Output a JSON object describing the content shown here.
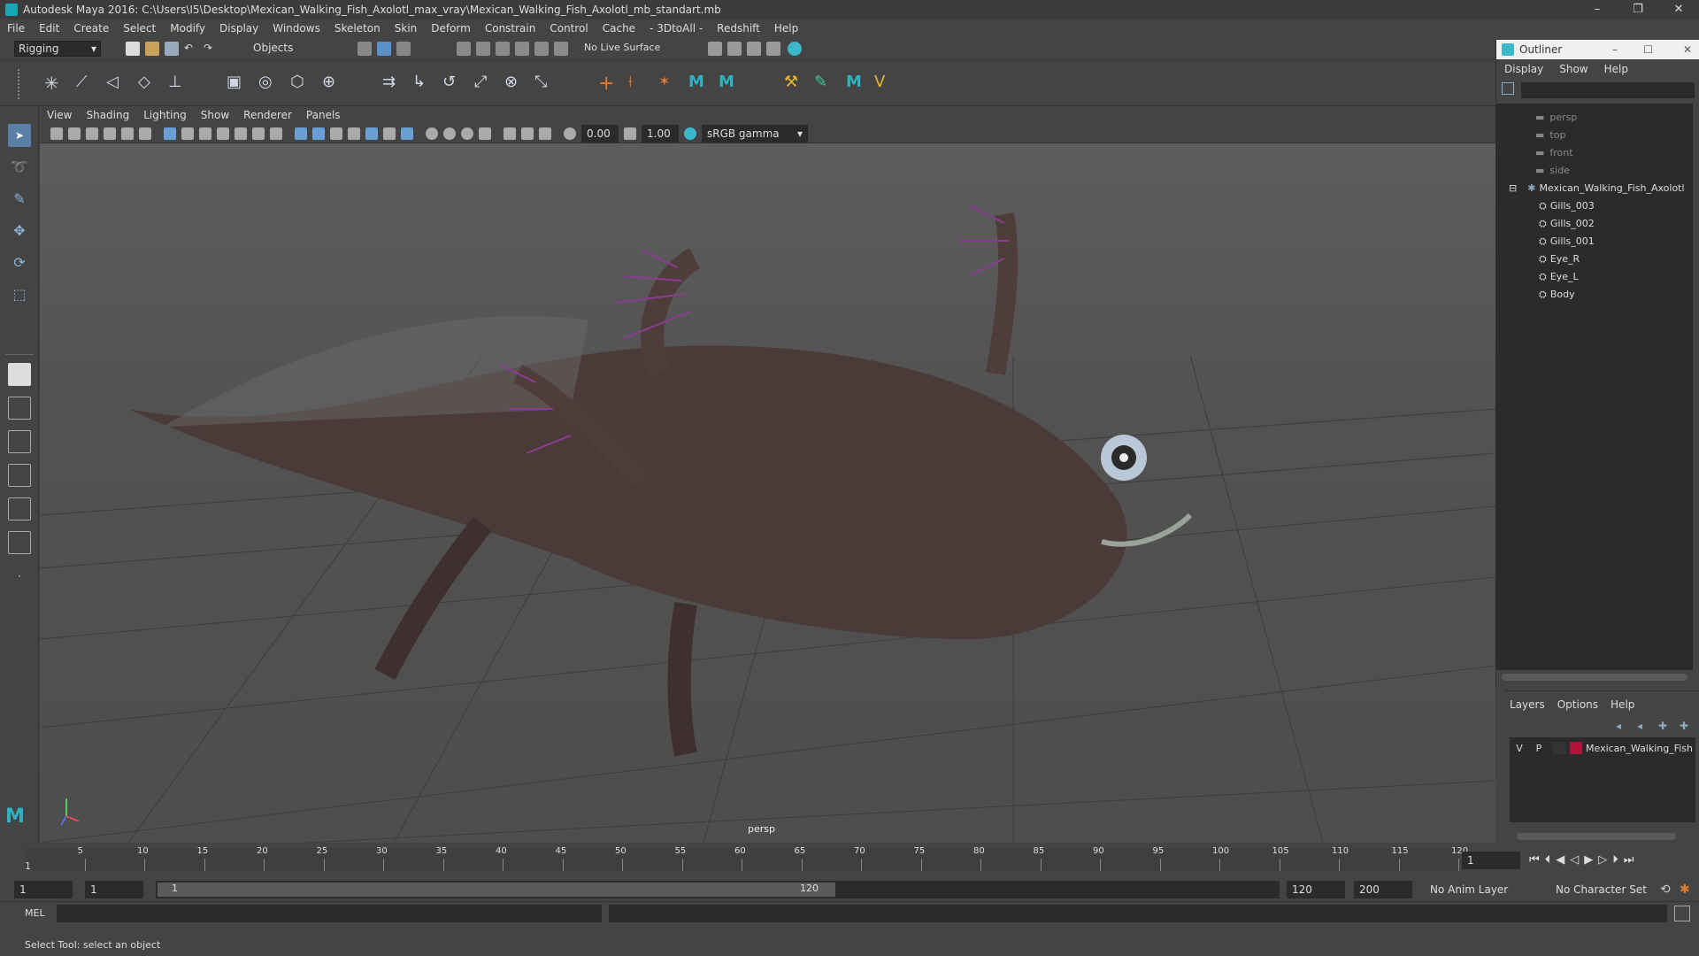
{
  "window": {
    "title": "Autodesk Maya 2016: C:\\Users\\I5\\Desktop\\Mexican_Walking_Fish_Axolotl_max_vray\\Mexican_Walking_Fish_Axolotl_mb_standart.mb",
    "minimize": "–",
    "restore": "❐",
    "close": "✕"
  },
  "menubar": [
    "File",
    "Edit",
    "Create",
    "Select",
    "Modify",
    "Display",
    "Windows",
    "Skeleton",
    "Skin",
    "Deform",
    "Constrain",
    "Control",
    "Cache",
    "- 3DtoAll -",
    "Redshift",
    "Help"
  ],
  "statusline": {
    "mode": "Rigging",
    "selection_mask": "Objects",
    "live_surface": "No Live Surface"
  },
  "panel_menu": [
    "View",
    "Shading",
    "Lighting",
    "Show",
    "Renderer",
    "Panels"
  ],
  "panel_toolbar": {
    "exposure": "0.00",
    "gamma": "1.00",
    "color_space": "sRGB gamma"
  },
  "viewport": {
    "camera_label": "persp"
  },
  "outliner": {
    "title": "Outliner",
    "menu": [
      "Display",
      "Show",
      "Help"
    ],
    "items": [
      {
        "label": "persp",
        "kind": "camera",
        "depth": 0
      },
      {
        "label": "top",
        "kind": "camera",
        "depth": 0
      },
      {
        "label": "front",
        "kind": "camera",
        "depth": 0
      },
      {
        "label": "side",
        "kind": "camera",
        "depth": 0
      },
      {
        "label": "Mexican_Walking_Fish_Axolotl",
        "kind": "group",
        "depth": 0
      },
      {
        "label": "Gills_003",
        "kind": "mesh",
        "depth": 1
      },
      {
        "label": "Gills_002",
        "kind": "mesh",
        "depth": 1
      },
      {
        "label": "Gills_001",
        "kind": "mesh",
        "depth": 1
      },
      {
        "label": "Eye_R",
        "kind": "mesh",
        "depth": 1
      },
      {
        "label": "Eye_L",
        "kind": "mesh",
        "depth": 1
      },
      {
        "label": "Body",
        "kind": "mesh",
        "depth": 1
      }
    ]
  },
  "layers": {
    "menu": [
      "Layers",
      "Options",
      "Help"
    ],
    "row": {
      "visible": "V",
      "playback": "P",
      "name": "Mexican_Walking_Fish",
      "color": "#b0123a"
    }
  },
  "timeline": {
    "ticks": [
      "5",
      "10",
      "15",
      "20",
      "25",
      "30",
      "35",
      "40",
      "45",
      "50",
      "55",
      "60",
      "65",
      "70",
      "75",
      "80",
      "85",
      "90",
      "95",
      "100",
      "105",
      "110",
      "115",
      "120"
    ],
    "start_marker": "1",
    "current_frame": "1"
  },
  "range": {
    "start": "1",
    "playback_start": "1",
    "slider_start": "1",
    "slider_end": "120",
    "playback_end": "120",
    "end": "200",
    "anim_layer": "No Anim Layer",
    "character_set": "No Character Set"
  },
  "commandline": {
    "language": "MEL"
  },
  "helpline": {
    "text": "Select Tool: select an object"
  }
}
